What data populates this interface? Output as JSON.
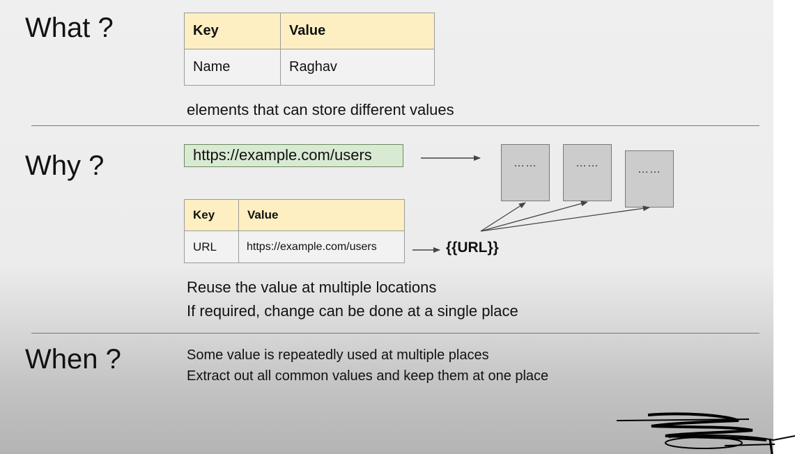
{
  "what": {
    "heading": "What ?",
    "table": {
      "headers": [
        "Key",
        "Value"
      ],
      "rows": [
        [
          "Name",
          "Raghav"
        ]
      ]
    },
    "caption": "elements that can store different values"
  },
  "why": {
    "heading": "Why ?",
    "url": "https://example.com/users",
    "pages": [
      "……",
      "……",
      "……"
    ],
    "table": {
      "headers": [
        "Key",
        "Value"
      ],
      "rows": [
        [
          "URL",
          "https://example.com/users"
        ]
      ]
    },
    "placeholder": "{{URL}}",
    "captions": [
      "Reuse the value at multiple locations",
      "If required, change can be done at a single place"
    ]
  },
  "when": {
    "heading": "When ?",
    "captions": [
      "Some value is repeatedly used at multiple places",
      "Extract out all common values and keep them at one place"
    ]
  },
  "colors": {
    "header_fill": "#fdefc2",
    "url_fill": "#d9ead3",
    "page_fill": "#cccccc"
  }
}
